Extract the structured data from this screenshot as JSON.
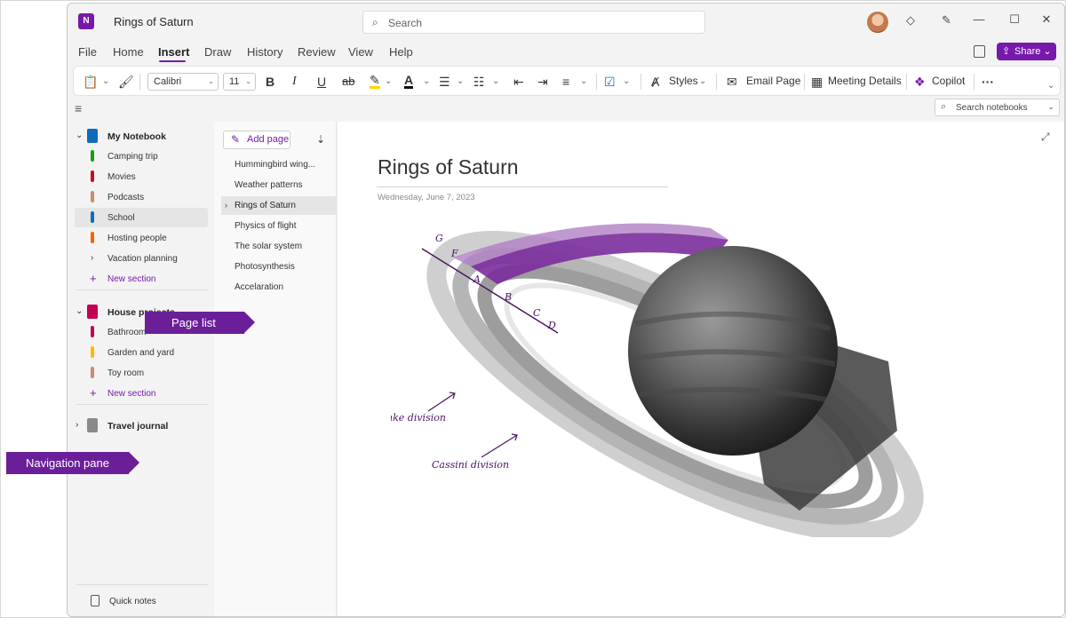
{
  "app": {
    "logo": "N",
    "title": "Rings of Saturn",
    "search_placeholder": "Search"
  },
  "titlebar_icons": [
    "diamond-icon",
    "pen-icon",
    "minimize-icon",
    "maximize-icon",
    "close-icon"
  ],
  "menu": {
    "tabs": [
      "File",
      "Home",
      "Insert",
      "Draw",
      "History",
      "Review",
      "View",
      "Help"
    ],
    "active_tab": "Insert",
    "share_label": "Share"
  },
  "ribbon": {
    "font_name": "Calibri",
    "font_size": "11",
    "bold": "B",
    "italic": "I",
    "underline": "U",
    "strike": "ab",
    "styles_label": "Styles",
    "email_page_label": "Email Page",
    "meeting_details_label": "Meeting Details",
    "copilot_label": "Copilot",
    "more": "···"
  },
  "search_notebooks": {
    "placeholder": "Search notebooks"
  },
  "nav": {
    "notebooks": [
      {
        "name": "My Notebook",
        "color": "#0f6cbd",
        "sections": [
          {
            "name": "Camping trip",
            "color": "#13a10e"
          },
          {
            "name": "Movies",
            "color": "#c50f1f"
          },
          {
            "name": "Podcasts",
            "color": "#c78d6b"
          },
          {
            "name": "School",
            "color": "#0f6cbd",
            "selected": true
          },
          {
            "name": "Hosting people",
            "color": "#f7630c"
          },
          {
            "name": "Vacation planning",
            "group": true
          }
        ],
        "new_section": "New section"
      },
      {
        "name": "House projects",
        "color": "#c30052",
        "sections": [
          {
            "name": "Bathroom",
            "color": "#c30052"
          },
          {
            "name": "Garden and yard",
            "color": "#ffb900"
          },
          {
            "name": "Toy room",
            "color": "#c78d6b"
          }
        ],
        "new_section": "New section"
      },
      {
        "name": "Travel journal",
        "color": "#8a8a8a",
        "collapsed": true
      }
    ],
    "quick_notes": "Quick notes"
  },
  "page_list": {
    "add_page": "Add page",
    "pages": [
      "Hummingbird wing...",
      "Weather patterns",
      "Rings of Saturn",
      "Physics of flight",
      "The solar system",
      "Photosynthesis",
      "Accelaration"
    ],
    "selected": "Rings of Saturn"
  },
  "page": {
    "title": "Rings of Saturn",
    "date": "Wednesday, June 7, 2023",
    "ink_labels": {
      "g": "G",
      "f": "F",
      "a": "A",
      "b": "B",
      "c": "C",
      "d": "D",
      "encke": "Enke division",
      "cassini": "Cassini division"
    }
  },
  "callouts": {
    "page_list": "Page list",
    "navigation_pane": "Navigation pane"
  },
  "colors": {
    "accent": "#7719aa",
    "callout": "#6a1f98"
  }
}
